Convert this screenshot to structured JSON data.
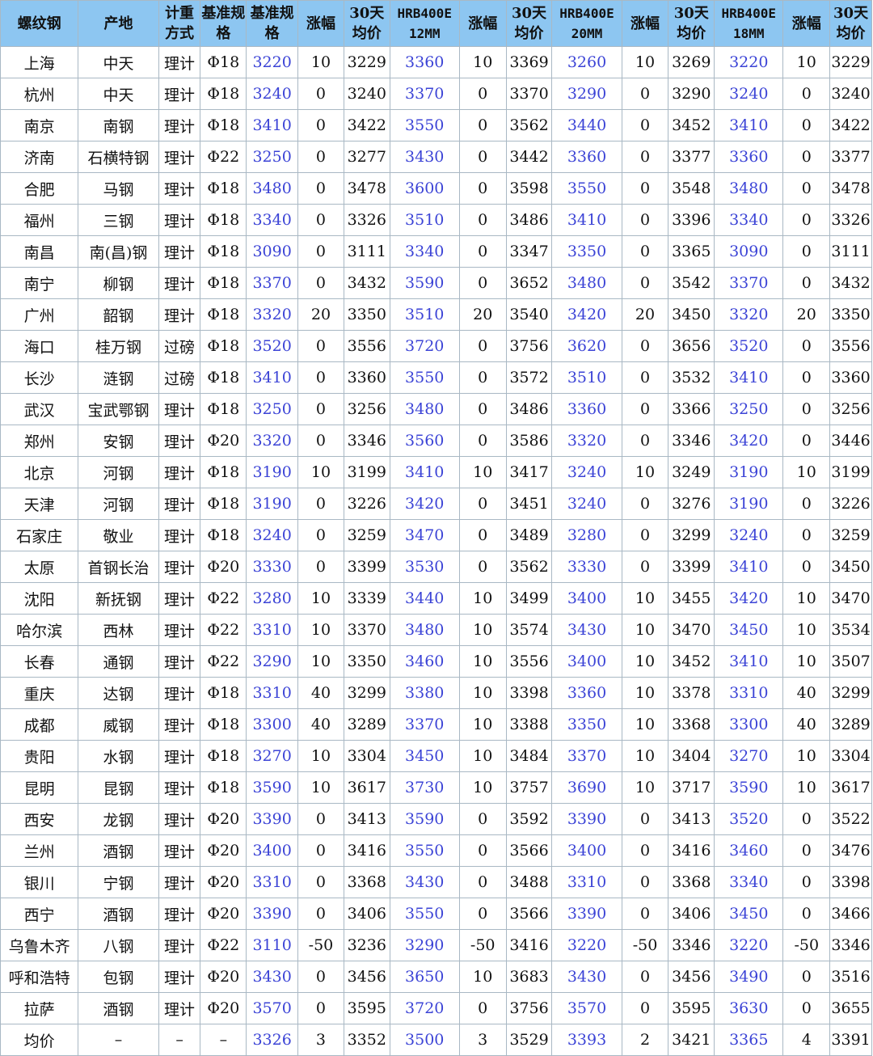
{
  "header": [
    "螺纹钢",
    "产地",
    "计重方式",
    "基准规格",
    "基准规格",
    "涨幅",
    "30天均价",
    "HRB400E 12MM",
    "涨幅",
    "30天均价",
    "HRB400E 20MM",
    "涨幅",
    "30天均价",
    "HRB400E 18MM",
    "涨幅",
    "30天均价"
  ],
  "rows": [
    [
      "上海",
      "中天",
      "理计",
      "Φ18",
      "3220",
      "10",
      "3229",
      "3360",
      "10",
      "3369",
      "3260",
      "10",
      "3269",
      "3220",
      "10",
      "3229"
    ],
    [
      "杭州",
      "中天",
      "理计",
      "Φ18",
      "3240",
      "0",
      "3240",
      "3370",
      "0",
      "3370",
      "3290",
      "0",
      "3290",
      "3240",
      "0",
      "3240"
    ],
    [
      "南京",
      "南钢",
      "理计",
      "Φ18",
      "3410",
      "0",
      "3422",
      "3550",
      "0",
      "3562",
      "3440",
      "0",
      "3452",
      "3410",
      "0",
      "3422"
    ],
    [
      "济南",
      "石横特钢",
      "理计",
      "Φ22",
      "3250",
      "0",
      "3277",
      "3430",
      "0",
      "3442",
      "3360",
      "0",
      "3377",
      "3360",
      "0",
      "3377"
    ],
    [
      "合肥",
      "马钢",
      "理计",
      "Φ18",
      "3480",
      "0",
      "3478",
      "3600",
      "0",
      "3598",
      "3550",
      "0",
      "3548",
      "3480",
      "0",
      "3478"
    ],
    [
      "福州",
      "三钢",
      "理计",
      "Φ18",
      "3340",
      "0",
      "3326",
      "3510",
      "0",
      "3486",
      "3410",
      "0",
      "3396",
      "3340",
      "0",
      "3326"
    ],
    [
      "南昌",
      "南(昌)钢",
      "理计",
      "Φ18",
      "3090",
      "0",
      "3111",
      "3340",
      "0",
      "3347",
      "3350",
      "0",
      "3365",
      "3090",
      "0",
      "3111"
    ],
    [
      "南宁",
      "柳钢",
      "理计",
      "Φ18",
      "3370",
      "0",
      "3432",
      "3590",
      "0",
      "3652",
      "3480",
      "0",
      "3542",
      "3370",
      "0",
      "3432"
    ],
    [
      "广州",
      "韶钢",
      "理计",
      "Φ18",
      "3320",
      "20",
      "3350",
      "3510",
      "20",
      "3540",
      "3420",
      "20",
      "3450",
      "3320",
      "20",
      "3350"
    ],
    [
      "海口",
      "桂万钢",
      "过磅",
      "Φ18",
      "3520",
      "0",
      "3556",
      "3720",
      "0",
      "3756",
      "3620",
      "0",
      "3656",
      "3520",
      "0",
      "3556"
    ],
    [
      "长沙",
      "涟钢",
      "过磅",
      "Φ18",
      "3410",
      "0",
      "3360",
      "3550",
      "0",
      "3572",
      "3510",
      "0",
      "3532",
      "3410",
      "0",
      "3360"
    ],
    [
      "武汉",
      "宝武鄂钢",
      "理计",
      "Φ18",
      "3250",
      "0",
      "3256",
      "3480",
      "0",
      "3486",
      "3360",
      "0",
      "3366",
      "3250",
      "0",
      "3256"
    ],
    [
      "郑州",
      "安钢",
      "理计",
      "Φ20",
      "3320",
      "0",
      "3346",
      "3560",
      "0",
      "3586",
      "3320",
      "0",
      "3346",
      "3420",
      "0",
      "3446"
    ],
    [
      "北京",
      "河钢",
      "理计",
      "Φ18",
      "3190",
      "10",
      "3199",
      "3410",
      "10",
      "3417",
      "3240",
      "10",
      "3249",
      "3190",
      "10",
      "3199"
    ],
    [
      "天津",
      "河钢",
      "理计",
      "Φ18",
      "3190",
      "0",
      "3226",
      "3420",
      "0",
      "3451",
      "3240",
      "0",
      "3276",
      "3190",
      "0",
      "3226"
    ],
    [
      "石家庄",
      "敬业",
      "理计",
      "Φ18",
      "3240",
      "0",
      "3259",
      "3470",
      "0",
      "3489",
      "3280",
      "0",
      "3299",
      "3240",
      "0",
      "3259"
    ],
    [
      "太原",
      "首钢长治",
      "理计",
      "Φ20",
      "3330",
      "0",
      "3399",
      "3530",
      "0",
      "3562",
      "3330",
      "0",
      "3399",
      "3410",
      "0",
      "3450"
    ],
    [
      "沈阳",
      "新抚钢",
      "理计",
      "Φ22",
      "3280",
      "10",
      "3339",
      "3440",
      "10",
      "3499",
      "3400",
      "10",
      "3455",
      "3420",
      "10",
      "3470"
    ],
    [
      "哈尔滨",
      "西林",
      "理计",
      "Φ22",
      "3310",
      "10",
      "3370",
      "3480",
      "10",
      "3574",
      "3430",
      "10",
      "3470",
      "3450",
      "10",
      "3534"
    ],
    [
      "长春",
      "通钢",
      "理计",
      "Φ22",
      "3290",
      "10",
      "3350",
      "3460",
      "10",
      "3556",
      "3400",
      "10",
      "3452",
      "3410",
      "10",
      "3507"
    ],
    [
      "重庆",
      "达钢",
      "理计",
      "Φ18",
      "3310",
      "40",
      "3299",
      "3380",
      "10",
      "3398",
      "3360",
      "10",
      "3378",
      "3310",
      "40",
      "3299"
    ],
    [
      "成都",
      "威钢",
      "理计",
      "Φ18",
      "3300",
      "40",
      "3289",
      "3370",
      "10",
      "3388",
      "3350",
      "10",
      "3368",
      "3300",
      "40",
      "3289"
    ],
    [
      "贵阳",
      "水钢",
      "理计",
      "Φ18",
      "3270",
      "10",
      "3304",
      "3450",
      "10",
      "3484",
      "3370",
      "10",
      "3404",
      "3270",
      "10",
      "3304"
    ],
    [
      "昆明",
      "昆钢",
      "理计",
      "Φ18",
      "3590",
      "10",
      "3617",
      "3730",
      "10",
      "3757",
      "3690",
      "10",
      "3717",
      "3590",
      "10",
      "3617"
    ],
    [
      "西安",
      "龙钢",
      "理计",
      "Φ20",
      "3390",
      "0",
      "3413",
      "3590",
      "0",
      "3592",
      "3390",
      "0",
      "3413",
      "3520",
      "0",
      "3522"
    ],
    [
      "兰州",
      "酒钢",
      "理计",
      "Φ20",
      "3400",
      "0",
      "3416",
      "3550",
      "0",
      "3566",
      "3400",
      "0",
      "3416",
      "3460",
      "0",
      "3476"
    ],
    [
      "银川",
      "宁钢",
      "理计",
      "Φ20",
      "3310",
      "0",
      "3368",
      "3430",
      "0",
      "3488",
      "3310",
      "0",
      "3368",
      "3340",
      "0",
      "3398"
    ],
    [
      "西宁",
      "酒钢",
      "理计",
      "Φ20",
      "3390",
      "0",
      "3406",
      "3550",
      "0",
      "3566",
      "3390",
      "0",
      "3406",
      "3450",
      "0",
      "3466"
    ],
    [
      "乌鲁木齐",
      "八钢",
      "理计",
      "Φ22",
      "3110",
      "-50",
      "3236",
      "3290",
      "-50",
      "3416",
      "3220",
      "-50",
      "3346",
      "3220",
      "-50",
      "3346"
    ],
    [
      "呼和浩特",
      "包钢",
      "理计",
      "Φ20",
      "3430",
      "0",
      "3456",
      "3650",
      "10",
      "3683",
      "3430",
      "0",
      "3456",
      "3490",
      "0",
      "3516"
    ],
    [
      "拉萨",
      "酒钢",
      "理计",
      "Φ20",
      "3570",
      "0",
      "3595",
      "3720",
      "0",
      "3756",
      "3570",
      "0",
      "3595",
      "3630",
      "0",
      "3655"
    ],
    [
      "均价",
      "–",
      "–",
      "–",
      "3326",
      "3",
      "3352",
      "3500",
      "3",
      "3529",
      "3393",
      "2",
      "3421",
      "3365",
      "4",
      "3391"
    ]
  ]
}
